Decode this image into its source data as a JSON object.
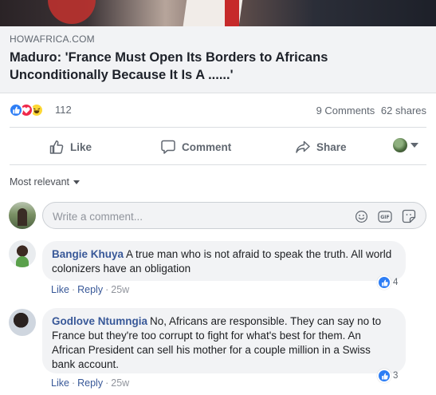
{
  "link": {
    "domain": "HOWAFRICA.COM",
    "title": "Maduro: 'France Must Open Its Borders to Africans Unconditionally Because It Is A ......'"
  },
  "stats": {
    "reaction_count": "112",
    "comments": "9 Comments",
    "shares": "62 shares",
    "reaction_types": [
      "like",
      "love",
      "haha"
    ]
  },
  "actions": {
    "like": "Like",
    "comment": "Comment",
    "share": "Share"
  },
  "sort": {
    "label": "Most relevant"
  },
  "composer": {
    "placeholder": "Write a comment..."
  },
  "comments": [
    {
      "author": "Bangie Khuya",
      "text": "A true man who is not afraid to speak the truth. All world colonizers have an obligation",
      "like_label": "Like",
      "reply_label": "Reply",
      "time": "25w",
      "reactions": "4"
    },
    {
      "author": "Godlove Ntumngia",
      "text": "No, Africans are responsible. They can say no to France but they're too corrupt to fight for what's best for them. An African President can sell his mother for a couple million in a Swiss bank account.",
      "like_label": "Like",
      "reply_label": "Reply",
      "time": "25w",
      "reactions": "3"
    }
  ],
  "colors": {
    "link_blue": "#385898",
    "like_blue": "#2e7ef5",
    "love_red": "#f0284a",
    "haha_yellow": "#fdd835",
    "bubble_bg": "#f2f3f5"
  }
}
